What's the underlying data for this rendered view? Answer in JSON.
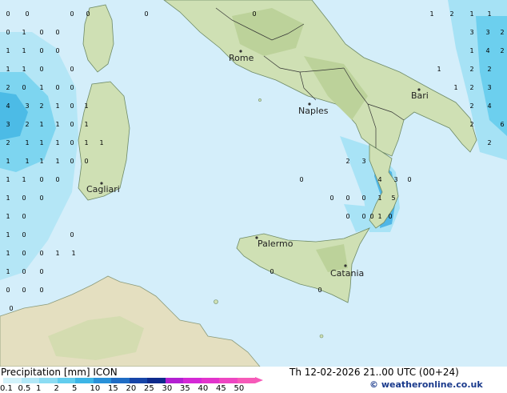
{
  "colors": {
    "sea": "#d4eefa",
    "land": "#cfe0b4",
    "land_dark": "#bcd29a",
    "desert": "#e6e0c2",
    "precip_light": "#a6e4f6",
    "precip_mid": "#6ccfee",
    "precip_strong": "#3aa8dc"
  },
  "cities": [
    {
      "name": "Rome"
    },
    {
      "name": "Naples"
    },
    {
      "name": "Bari"
    },
    {
      "name": "Cagliari"
    },
    {
      "name": "Palermo"
    },
    {
      "name": "Catania"
    }
  ],
  "value_labels": [
    "0",
    "0",
    "0",
    "0",
    "0",
    "0",
    "1",
    "2",
    "1",
    "1",
    "0",
    "1",
    "0",
    "0",
    "3",
    "3",
    "2",
    "1",
    "1",
    "0",
    "0",
    "1",
    "4",
    "2",
    "1",
    "1",
    "0",
    "0",
    "1",
    "2",
    "2",
    "2",
    "0",
    "1",
    "0",
    "0",
    "1",
    "2",
    "3",
    "4",
    "3",
    "2",
    "1",
    "0",
    "1",
    "2",
    "4",
    "3",
    "2",
    "1",
    "1",
    "0",
    "1",
    "2",
    "6",
    "2",
    "1",
    "1",
    "1",
    "0",
    "1",
    "1",
    "2",
    "1",
    "1",
    "1",
    "1",
    "0",
    "0",
    "2",
    "3",
    "1",
    "1",
    "0",
    "0",
    "0",
    "4",
    "3",
    "0",
    "1",
    "0",
    "0",
    "0",
    "0",
    "0",
    "1",
    "5",
    "1",
    "0",
    "0",
    "0",
    "0",
    "1",
    "0",
    "1",
    "0",
    "0",
    "1",
    "0",
    "0",
    "1",
    "1",
    "1",
    "0",
    "0",
    "0",
    "0",
    "0",
    "0",
    "0",
    "0"
  ],
  "footer": {
    "title": "Precipitation [mm] ICON",
    "datetime": "Th 12-02-2026 21..00 UTC (00+24)",
    "credit": "© weatheronline.co.uk"
  },
  "legend": {
    "levels": [
      "0.1",
      "0.5",
      "1",
      "2",
      "5",
      "10",
      "15",
      "20",
      "25",
      "30",
      "35",
      "40",
      "45",
      "50"
    ],
    "colors": [
      "#d2f2fa",
      "#b2e8f7",
      "#8cdcf3",
      "#62cdee",
      "#3cb5e6",
      "#2890d8",
      "#1f6cc4",
      "#1745a8",
      "#0e2a8c",
      "#b21fd2",
      "#d428d6",
      "#e233cc",
      "#ee46c2",
      "#f65ab8"
    ]
  }
}
